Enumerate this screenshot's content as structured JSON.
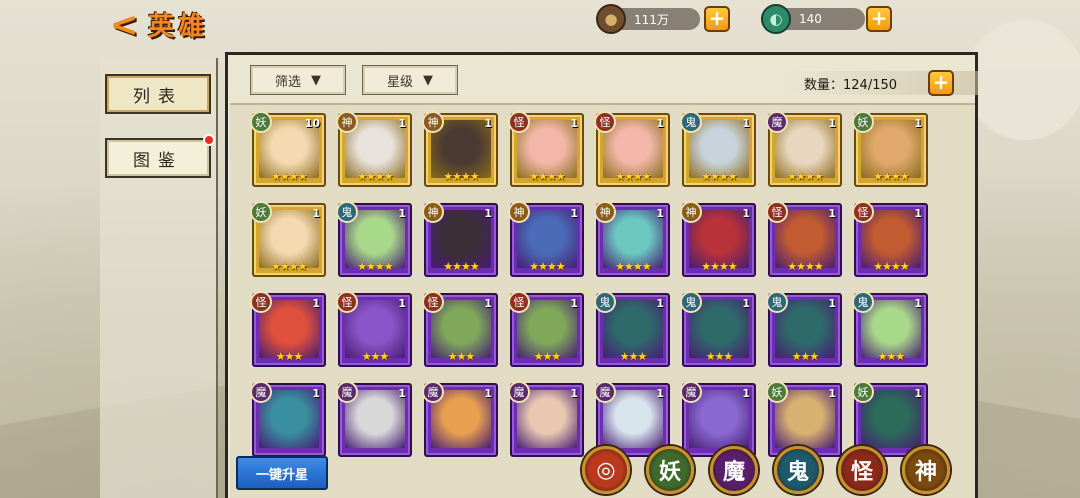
{
  "header": {
    "back_glyph": "<",
    "title": "英雄"
  },
  "resources": {
    "coins": "111万",
    "jade": "140",
    "plus": "+"
  },
  "nav": {
    "list_label": "列表",
    "codex_label": "图鉴"
  },
  "toolbar": {
    "filter_label": "筛选",
    "star_label": "星级",
    "dropdown_glyph": "▼",
    "count": "数量：124/150",
    "plus": "+"
  },
  "heroes": [
    {
      "faction": "妖",
      "level": "10",
      "stars": "★★★★",
      "frame": "gold",
      "skin": "#f4d9b0"
    },
    {
      "faction": "神",
      "level": "1",
      "stars": "★★★★",
      "frame": "gold",
      "skin": "#e8e2dc"
    },
    {
      "faction": "神",
      "level": "1",
      "stars": "★★★★",
      "frame": "gold",
      "skin": "#4a3a32"
    },
    {
      "faction": "怪",
      "level": "1",
      "stars": "★★★★",
      "frame": "gold",
      "skin": "#f2b7a8"
    },
    {
      "faction": "怪",
      "level": "1",
      "stars": "★★★★",
      "frame": "gold",
      "skin": "#f2b7a8"
    },
    {
      "faction": "鬼",
      "level": "1",
      "stars": "★★★★",
      "frame": "gold",
      "skin": "#c8d2da"
    },
    {
      "faction": "魔",
      "level": "1",
      "stars": "★★★★",
      "frame": "gold",
      "skin": "#e9d6bf"
    },
    {
      "faction": "妖",
      "level": "1",
      "stars": "★★★★",
      "frame": "gold",
      "skin": "#e0a86a"
    },
    {
      "faction": "妖",
      "level": "1",
      "stars": "★★★★",
      "frame": "gold",
      "skin": "#f4d9b0"
    },
    {
      "faction": "鬼",
      "level": "1",
      "stars": "★★★★",
      "frame": "purple",
      "skin": "#a8d88a"
    },
    {
      "faction": "神",
      "level": "1",
      "stars": "★★★★",
      "frame": "purple",
      "skin": "#3b2f36"
    },
    {
      "faction": "神",
      "level": "1",
      "stars": "★★★★",
      "frame": "purple",
      "skin": "#4b6bb8"
    },
    {
      "faction": "神",
      "level": "1",
      "stars": "★★★★",
      "frame": "purple",
      "skin": "#6cc7c0"
    },
    {
      "faction": "神",
      "level": "1",
      "stars": "★★★★",
      "frame": "purple",
      "skin": "#b8323a"
    },
    {
      "faction": "怪",
      "level": "1",
      "stars": "★★★★",
      "frame": "purple",
      "skin": "#c25a32"
    },
    {
      "faction": "怪",
      "level": "1",
      "stars": "★★★★",
      "frame": "purple",
      "skin": "#c25a32"
    },
    {
      "faction": "怪",
      "level": "1",
      "stars": "★★★",
      "frame": "purple",
      "skin": "#e0503c"
    },
    {
      "faction": "怪",
      "level": "1",
      "stars": "★★★",
      "frame": "purple",
      "skin": "#8a55c8"
    },
    {
      "faction": "怪",
      "level": "1",
      "stars": "★★★",
      "frame": "purple",
      "skin": "#7fa85a"
    },
    {
      "faction": "怪",
      "level": "1",
      "stars": "★★★",
      "frame": "purple",
      "skin": "#7fa85a"
    },
    {
      "faction": "鬼",
      "level": "1",
      "stars": "★★★",
      "frame": "purple",
      "skin": "#2f6a6a"
    },
    {
      "faction": "鬼",
      "level": "1",
      "stars": "★★★",
      "frame": "purple",
      "skin": "#2f6a6a"
    },
    {
      "faction": "鬼",
      "level": "1",
      "stars": "★★★",
      "frame": "purple",
      "skin": "#2f6a6a"
    },
    {
      "faction": "鬼",
      "level": "1",
      "stars": "★★★",
      "frame": "purple",
      "skin": "#a8d88a"
    },
    {
      "faction": "魔",
      "level": "1",
      "stars": "",
      "frame": "purple",
      "skin": "#3a8fa0"
    },
    {
      "faction": "魔",
      "level": "1",
      "stars": "",
      "frame": "purple",
      "skin": "#d8d8d8"
    },
    {
      "faction": "魔",
      "level": "1",
      "stars": "",
      "frame": "purple",
      "skin": "#e8a050"
    },
    {
      "faction": "魔",
      "level": "1",
      "stars": "",
      "frame": "purple",
      "skin": "#e8c8b0"
    },
    {
      "faction": "魔",
      "level": "1",
      "stars": "",
      "frame": "purple",
      "skin": "#d8e4ec"
    },
    {
      "faction": "魔",
      "level": "1",
      "stars": "",
      "frame": "purple",
      "skin": "#8a6ad0"
    },
    {
      "faction": "妖",
      "level": "1",
      "stars": "",
      "frame": "purple",
      "skin": "#d8b070"
    },
    {
      "faction": "妖",
      "level": "1",
      "stars": "",
      "frame": "purple",
      "skin": "#2c6a5a"
    }
  ],
  "faction_colors": {
    "妖": "#4c7a3a",
    "神": "#8a5a1e",
    "怪": "#8c3020",
    "鬼": "#2e6878",
    "魔": "#5a2a6a"
  },
  "bottom": {
    "upgrade_label": "一键升星",
    "filters": [
      {
        "label": "◎",
        "color": "#b83a1e",
        "name": "faction-all"
      },
      {
        "label": "妖",
        "color": "#3f6a2c",
        "name": "faction-yao"
      },
      {
        "label": "魔",
        "color": "#5a1f6a",
        "name": "faction-mo"
      },
      {
        "label": "鬼",
        "color": "#1f5a6c",
        "name": "faction-gui"
      },
      {
        "label": "怪",
        "color": "#8c2a1a",
        "name": "faction-guai"
      },
      {
        "label": "神",
        "color": "#7a4a10",
        "name": "faction-shen"
      }
    ]
  }
}
